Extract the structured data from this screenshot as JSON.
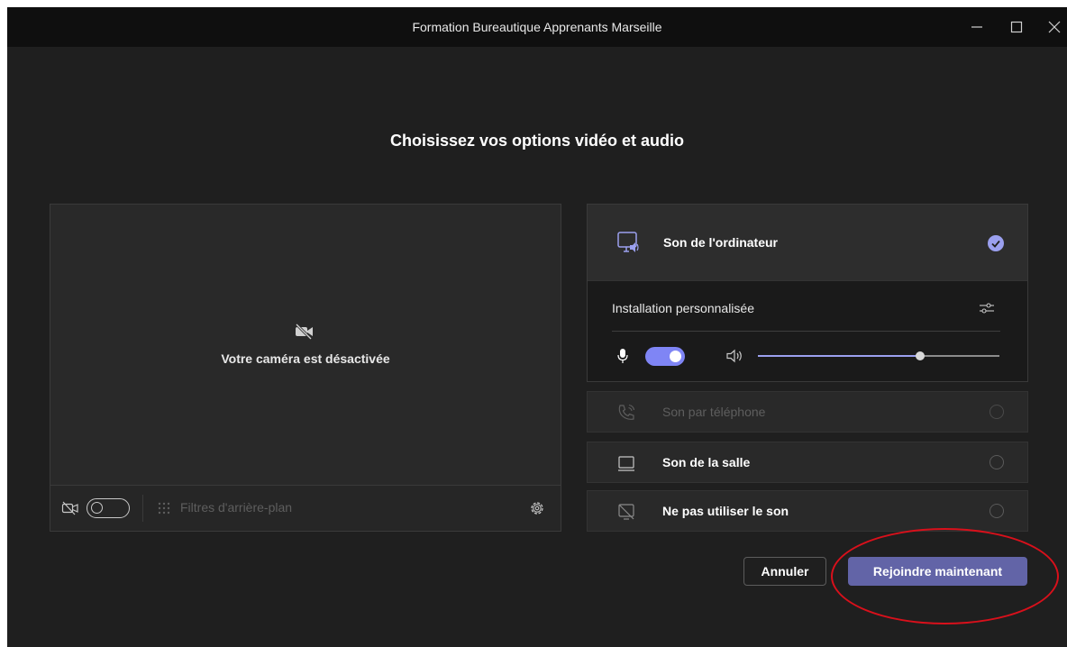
{
  "window": {
    "title": "Formation Bureautique Apprenants Marseille"
  },
  "page": {
    "heading": "Choisissez vos options vidéo et audio"
  },
  "video": {
    "camera_off_text": "Votre caméra est désactivée",
    "camera_toggle_on": false,
    "background_filters_label": "Filtres d'arrière-plan"
  },
  "audio": {
    "selected": {
      "label": "Son de l'ordinateur",
      "custom_setup_label": "Installation personnalisée",
      "mic_on": true,
      "volume_percent": 67
    },
    "options": [
      {
        "label": "Son par téléphone",
        "disabled": true
      },
      {
        "label": "Son de la salle",
        "disabled": false
      },
      {
        "label": "Ne pas utiliser le son",
        "disabled": false
      }
    ]
  },
  "actions": {
    "cancel_label": "Annuler",
    "join_label": "Rejoindre maintenant"
  },
  "colors": {
    "accent": "#6264a7",
    "accent_light": "#9ba0ef",
    "annotation": "#d9101b"
  }
}
